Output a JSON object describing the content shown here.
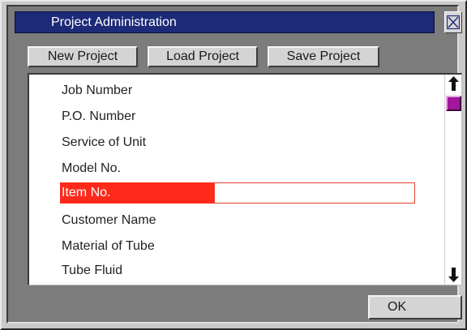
{
  "window": {
    "title": "Project Administration"
  },
  "toolbar": {
    "new_project": "New Project",
    "load_project": "Load Project",
    "save_project": "Save Project"
  },
  "fields": [
    {
      "label": "Job Number"
    },
    {
      "label": "P.O. Number"
    },
    {
      "label": "Service of Unit"
    },
    {
      "label": "Model No."
    },
    {
      "label": "Item No.",
      "selected": true,
      "value": ""
    },
    {
      "label": "Customer Name"
    },
    {
      "label": "Material of Tube"
    },
    {
      "label": "Tube Fluid"
    }
  ],
  "footer": {
    "ok_label": "OK"
  },
  "icons": {
    "close": "close-icon",
    "scroll_up": "arrow-up-icon",
    "scroll_down": "arrow-down-icon"
  },
  "colors": {
    "title_bar": "#1c2a78",
    "selection": "#ff2a1a",
    "scroll_thumb": "#a1189c",
    "frame": "#7c7c7c"
  }
}
